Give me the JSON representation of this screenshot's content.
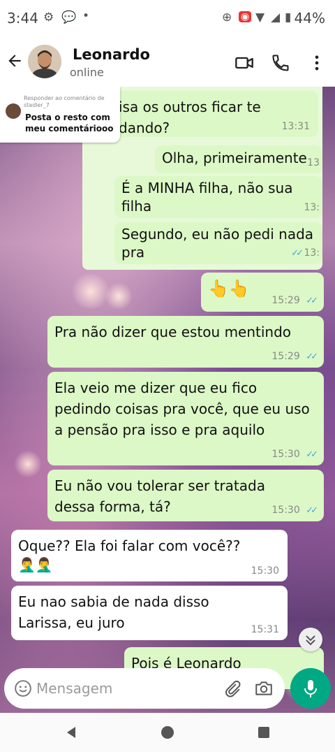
{
  "status_bar": {
    "time": "3:44",
    "battery": "44%"
  },
  "header": {
    "name": "Leonardo",
    "status": "online"
  },
  "comment_overlay": {
    "reply_label": "Responder ao comentário de stadler_7",
    "reply_text": "Posta o resto com meu comentáriooo"
  },
  "messages": [
    {
      "dir": "out",
      "text": "isa os outros ficar te dando?",
      "time": "13:31"
    },
    {
      "dir": "out",
      "text": "Olha, primeiramente",
      "time": "13"
    },
    {
      "dir": "out",
      "text": "É a MINHA filha, não sua filha",
      "time": "13:"
    },
    {
      "dir": "out",
      "text": "Segundo, eu não pedi nada pra",
      "time": "13:"
    },
    {
      "dir": "out",
      "text": "👆👆",
      "time": "15:29"
    },
    {
      "dir": "out",
      "text": "Pra não dizer que estou mentindo",
      "time": "15:29"
    },
    {
      "dir": "out",
      "text": "Ela veio me dizer que eu fico pedindo coisas pra você, que eu uso a pensão pra isso e pra aquilo",
      "time": "15:30"
    },
    {
      "dir": "out",
      "text": "Eu não vou tolerar ser tratada dessa forma, tá?",
      "time": "15:30"
    },
    {
      "dir": "in",
      "text": "Oque?? Ela foi falar com você??",
      "emoji": "🤦‍♂️🤦‍♂️",
      "time": "15:30"
    },
    {
      "dir": "in",
      "text": "Eu nao sabia de nada disso Larissa, eu juro",
      "time": "15:31"
    },
    {
      "dir": "out",
      "text": "Pois é Leonardo",
      "time": ""
    }
  ],
  "input": {
    "placeholder": "Mensagem"
  },
  "colors": {
    "outgoing_bubble": "#dcf8c6",
    "incoming_bubble": "#ffffff",
    "accent": "#00a884",
    "read_tick": "#4aa3df"
  }
}
